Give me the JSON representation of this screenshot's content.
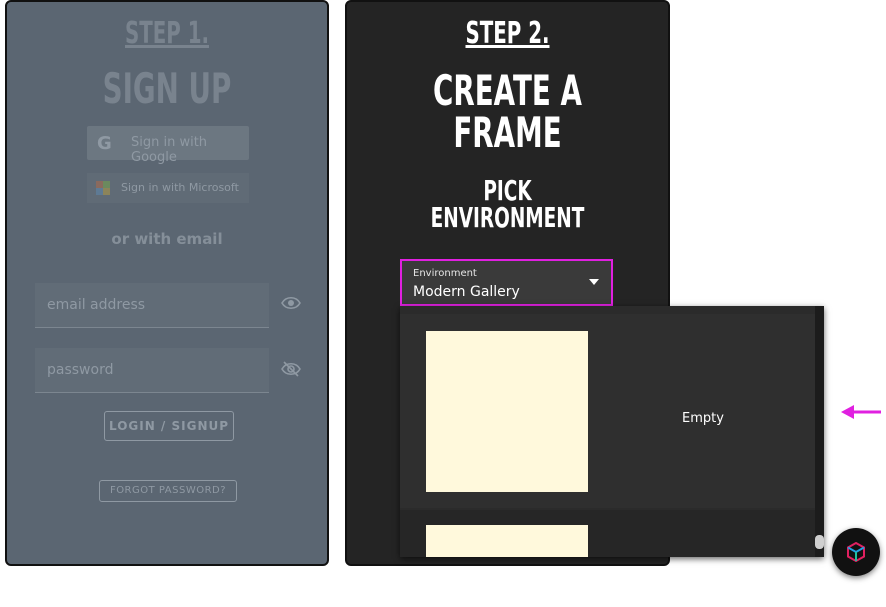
{
  "step1": {
    "step_label": "STEP 1.",
    "title": "SIGN UP",
    "google_button": "Sign in with Google",
    "microsoft_button": "Sign in with Microsoft",
    "or_with_email": "or with email",
    "email_placeholder": "email address",
    "password_placeholder": "password",
    "login_button": "LOGIN / SIGNUP",
    "forgot_button": "FORGOT PASSWORD?"
  },
  "step2": {
    "step_label": "STEP 2.",
    "title_line1": "CREATE A",
    "title_line2": "FRAME",
    "subtitle_line1": "PICK",
    "subtitle_line2": "ENVIRONMENT",
    "select_label": "Environment",
    "select_value": "Modern Gallery",
    "options": [
      {
        "label": "Empty"
      },
      {
        "label": ""
      }
    ]
  },
  "colors": {
    "highlight": "#e020e0",
    "thumbnail": "#fff9dc"
  }
}
